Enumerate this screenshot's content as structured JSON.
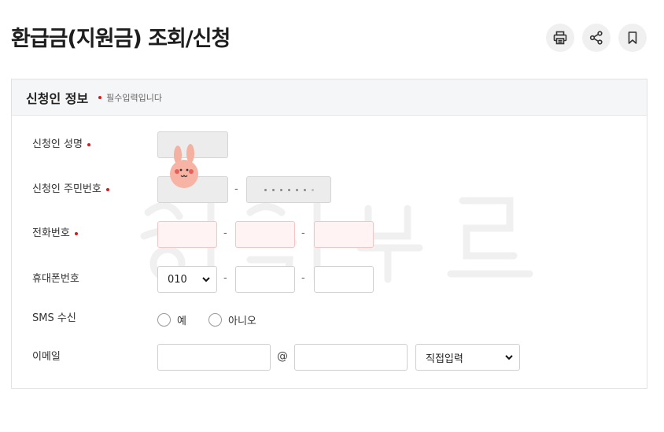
{
  "page": {
    "title": "환급금(지원금) 조회/신청"
  },
  "toolbar": [
    {
      "name": "print-button",
      "icon": "print-icon"
    },
    {
      "name": "share-button",
      "icon": "share-icon"
    },
    {
      "name": "bookmark-button",
      "icon": "bookmark-icon"
    }
  ],
  "section": {
    "title": "신청인 정보",
    "required_note": "필수입력입니다"
  },
  "fields": {
    "name_label": "신청인 성명",
    "resident_label": "신청인 주민번호",
    "phone_label": "전화번호",
    "mobile_label": "휴대폰번호",
    "sms_label": "SMS 수신",
    "email_label": "이메일"
  },
  "mobile": {
    "prefix_selected": "010"
  },
  "separators": {
    "dash": "-",
    "at": "@"
  },
  "sms": {
    "yes": "예",
    "no": "아니오"
  },
  "email": {
    "domain_selected": "직접입력"
  },
  "colors": {
    "required": "#d7191c",
    "disabled_bg": "#ececec",
    "invalid_bg": "#fff3f3"
  }
}
